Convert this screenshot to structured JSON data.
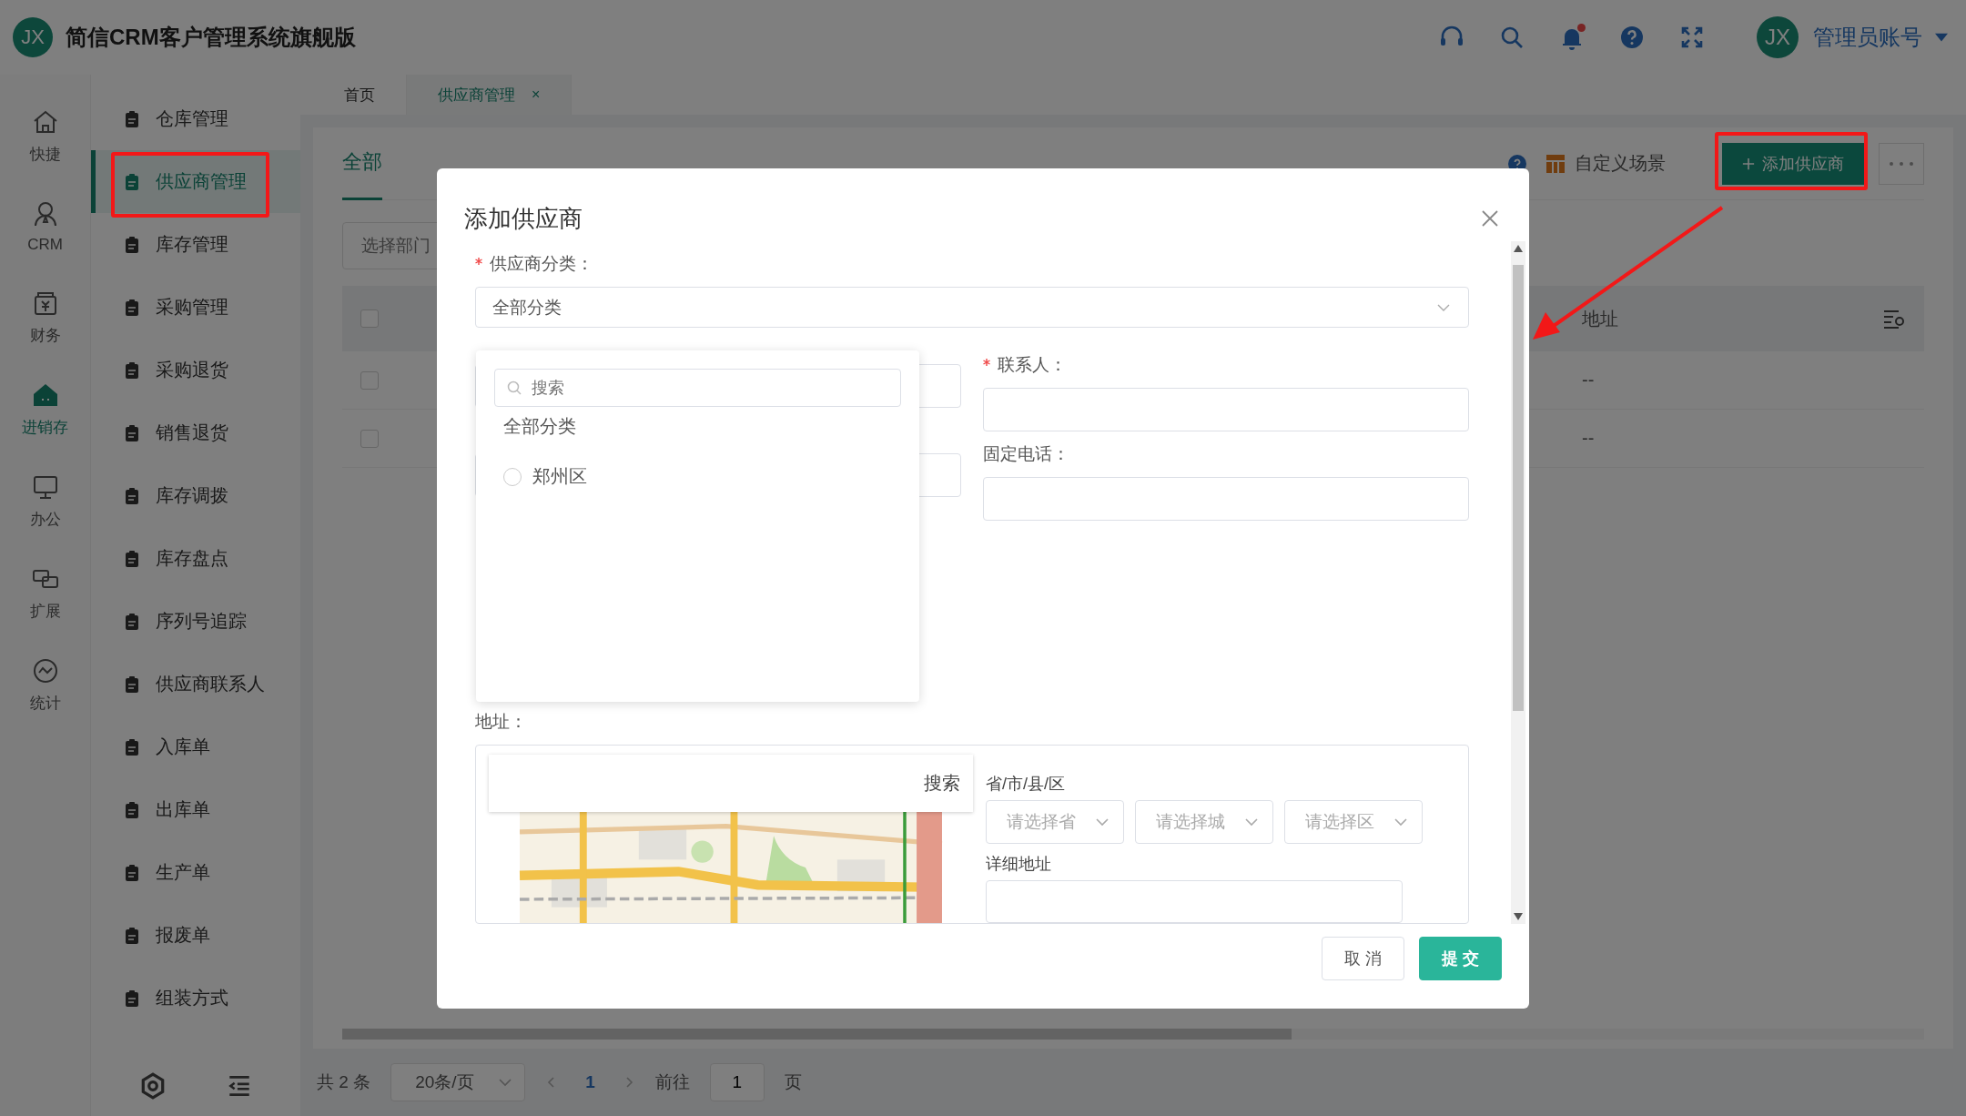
{
  "app": {
    "logo": "JX",
    "title": "简信CRM客户管理系统旗舰版"
  },
  "header": {
    "unread": true,
    "user_avatar": "JX",
    "user_name": "管理员账号"
  },
  "nav_rail": [
    {
      "label": "快捷",
      "selected": false
    },
    {
      "label": "CRM",
      "selected": false
    },
    {
      "label": "财务",
      "selected": false
    },
    {
      "label": "进销存",
      "selected": true
    },
    {
      "label": "办公",
      "selected": false
    },
    {
      "label": "扩展",
      "selected": false
    },
    {
      "label": "统计",
      "selected": false
    }
  ],
  "submenu": [
    {
      "label": "仓库管理",
      "selected": false
    },
    {
      "label": "供应商管理",
      "selected": true
    },
    {
      "label": "库存管理",
      "selected": false
    },
    {
      "label": "采购管理",
      "selected": false
    },
    {
      "label": "采购退货",
      "selected": false
    },
    {
      "label": "销售退货",
      "selected": false
    },
    {
      "label": "库存调拨",
      "selected": false
    },
    {
      "label": "库存盘点",
      "selected": false
    },
    {
      "label": "序列号追踪",
      "selected": false
    },
    {
      "label": "供应商联系人",
      "selected": false
    },
    {
      "label": "入库单",
      "selected": false
    },
    {
      "label": "出库单",
      "selected": false
    },
    {
      "label": "生产单",
      "selected": false
    },
    {
      "label": "报废单",
      "selected": false
    },
    {
      "label": "组装方式",
      "selected": false
    }
  ],
  "page_tabs": [
    {
      "label": "首页",
      "selected": false
    },
    {
      "label": "供应商管理",
      "selected": true,
      "close": "×"
    }
  ],
  "toolbar": {
    "tabs": [
      {
        "label": "全部",
        "selected": true
      }
    ],
    "custom_scene": "自定义场景",
    "add_button": "添加供应商"
  },
  "filter": {
    "placeholder": "选择部门"
  },
  "table": {
    "select_all": {
      "checked": false
    },
    "columns": [
      {
        "label": "地址"
      }
    ],
    "rows": [
      {
        "checked": false,
        "address": "--"
      },
      {
        "checked": false,
        "address": "--"
      }
    ]
  },
  "pagination": {
    "total": "共 2 条",
    "page_size": "20条/页",
    "pages": [
      {
        "label": "1",
        "selected": true
      }
    ],
    "goto_label": "前往",
    "goto_value": "1",
    "goto_suffix": "页"
  },
  "dialog": {
    "title": "添加供应商",
    "category": {
      "label": "供应商分类：",
      "required": true,
      "value": "全部分类"
    },
    "category_dropdown": {
      "search_placeholder": "搜索",
      "options": [
        {
          "label": "全部分类",
          "kind": "heading"
        },
        {
          "label": "郑州区",
          "kind": "radio",
          "selected": false
        }
      ]
    },
    "fields": [
      {
        "label": "联系人：",
        "required": true
      },
      {
        "label": "固定电话：",
        "required": false
      }
    ],
    "address": {
      "label": "地址：",
      "search_button": "搜索",
      "region_label": "省/市/县/区",
      "region_selects": [
        {
          "placeholder": "请选择省"
        },
        {
          "placeholder": "请选择城"
        },
        {
          "placeholder": "请选择区"
        }
      ],
      "detail_label": "详细地址"
    },
    "buttons": [
      {
        "label": "取 消",
        "kind": "default"
      },
      {
        "label": "提 交",
        "kind": "primary"
      }
    ]
  }
}
